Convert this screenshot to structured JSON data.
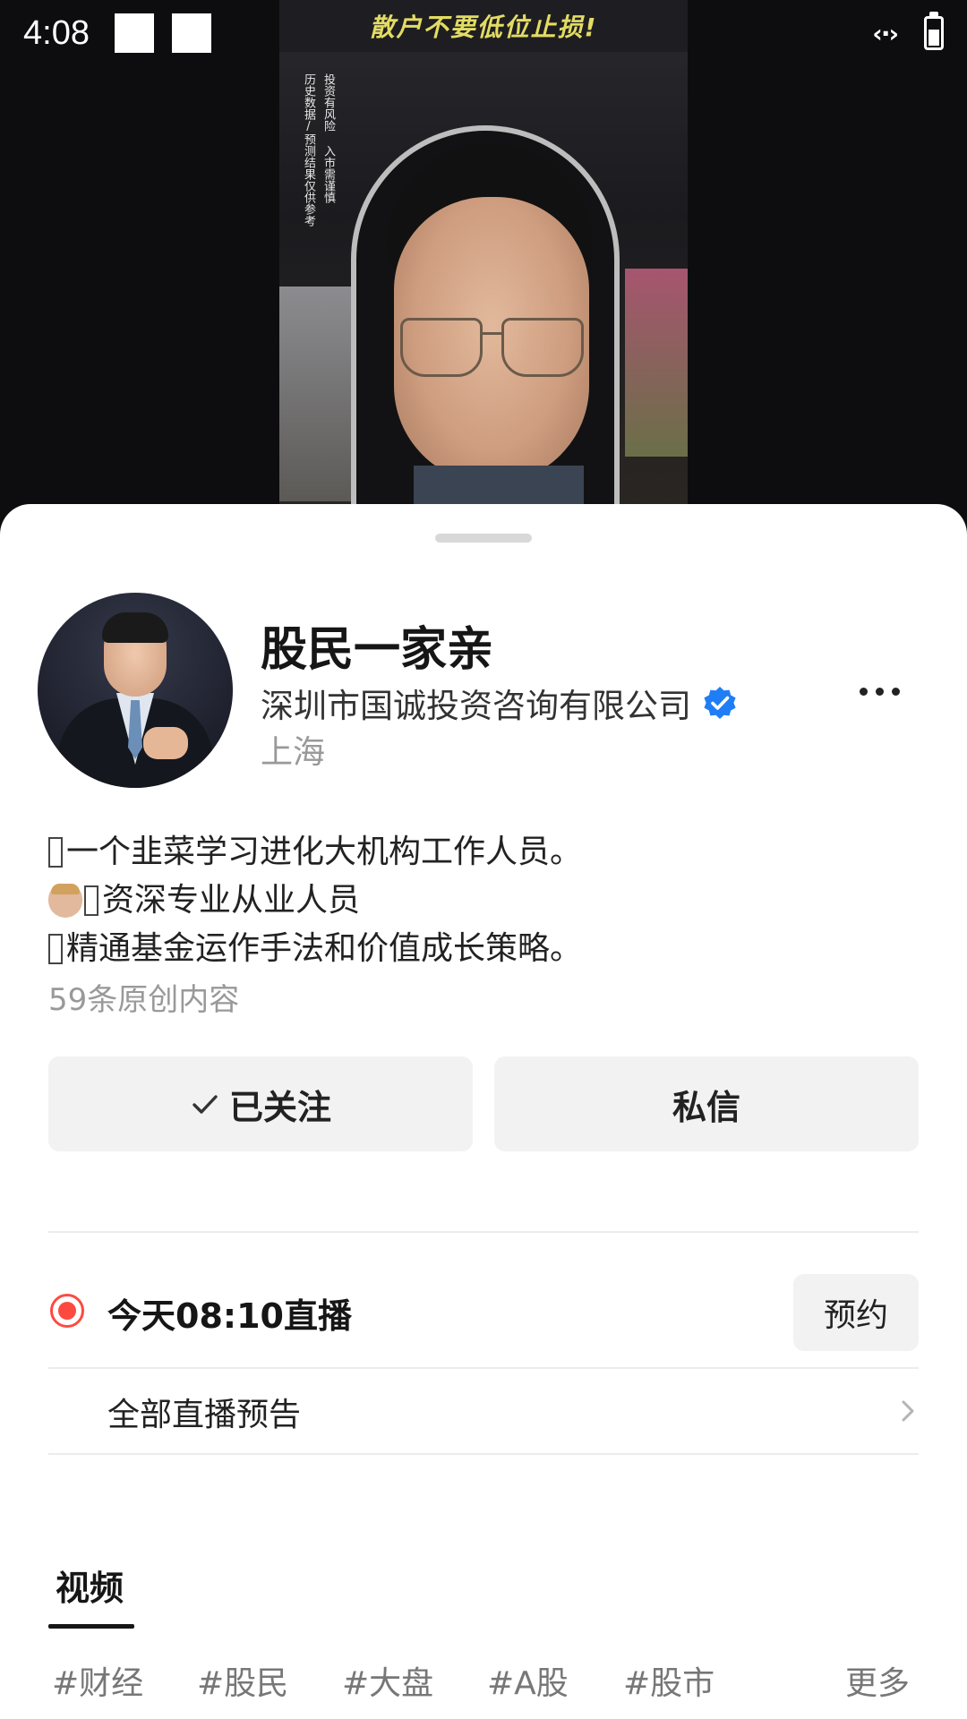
{
  "status_bar": {
    "time": "4:08",
    "icons": [
      "notification-square-icon",
      "notification-square-icon",
      "data-transfer-icon",
      "battery-icon"
    ],
    "data_glyph": "‹·›"
  },
  "video": {
    "banner_text": "散户不要低位止损!",
    "disclaimer": [
      "投资有风险 入市需谨慎",
      "历史数据/预测结果仅供参考"
    ]
  },
  "profile": {
    "name": "股民一家亲",
    "company": "深圳市国诚投资咨询有限公司",
    "verified": true,
    "location": "上海",
    "more_label": "更多操作"
  },
  "bio": {
    "lines": [
      "一个韭菜学习进化大机构工作人员。",
      "资深专业从业人员",
      "精通基金运作手法和价值成长策略。"
    ],
    "post_count": "59条原创内容"
  },
  "actions": {
    "follow_label": "已关注",
    "message_label": "私信"
  },
  "live": {
    "schedule_text": "今天08:10直播",
    "reserve_label": "预约",
    "all_previews_label": "全部直播预告"
  },
  "tabs": [
    {
      "label": "视频",
      "active": true
    }
  ],
  "tags": [
    "#财经",
    "#股民",
    "#大盘",
    "#A股",
    "#股市"
  ],
  "tags_more_label": "更多",
  "colors": {
    "live_accent": "#fd4a40",
    "verified_blue": "#1f7ef5",
    "button_bg": "#f2f2f2"
  }
}
